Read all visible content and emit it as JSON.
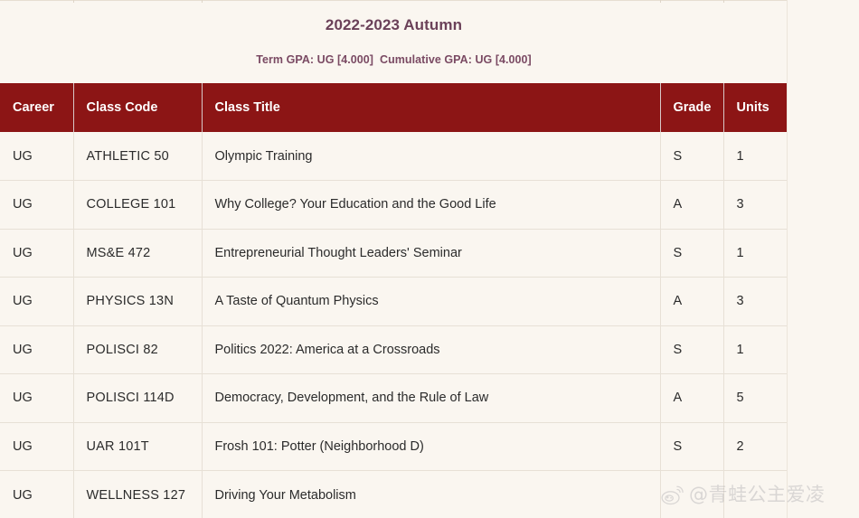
{
  "term": {
    "title": "2022-2023 Autumn",
    "gpa_line": "Term GPA: UG [4.000]  Cumulative GPA: UG [4.000]"
  },
  "table": {
    "columns": [
      "Career",
      "Class Code",
      "Class Title",
      "Grade",
      "Units"
    ],
    "header_bg": "#8C1515",
    "header_fg": "#FFFFFF",
    "page_bg": "#FAF6F0",
    "title_color": "#6B4159",
    "rows": [
      {
        "career": "UG",
        "code": "ATHLETIC  50",
        "title": "Olympic Training",
        "grade": "S",
        "units": "1"
      },
      {
        "career": "UG",
        "code": "COLLEGE  101",
        "title": "Why College? Your Education and the Good Life",
        "grade": "A",
        "units": "3"
      },
      {
        "career": "UG",
        "code": "MS&E  472",
        "title": "Entrepreneurial Thought Leaders' Seminar",
        "grade": "S",
        "units": "1"
      },
      {
        "career": "UG",
        "code": "PHYSICS  13N",
        "title": "A Taste of Quantum Physics",
        "grade": "A",
        "units": "3"
      },
      {
        "career": "UG",
        "code": "POLISCI  82",
        "title": "Politics 2022: America at a Crossroads",
        "grade": "S",
        "units": "1"
      },
      {
        "career": "UG",
        "code": "POLISCI  114D",
        "title": "Democracy, Development, and the Rule of Law",
        "grade": "A",
        "units": "5"
      },
      {
        "career": "UG",
        "code": "UAR  101T",
        "title": "Frosh 101: Potter (Neighborhood D)",
        "grade": "S",
        "units": "2"
      },
      {
        "career": "UG",
        "code": "WELLNESS  127",
        "title": "Driving Your Metabolism",
        "grade": "",
        "units": ""
      }
    ]
  },
  "watermark": {
    "handle": "@青蛙公主爱凌",
    "logo_icon": "weibo-logo-icon",
    "color": "#8F8F96"
  }
}
